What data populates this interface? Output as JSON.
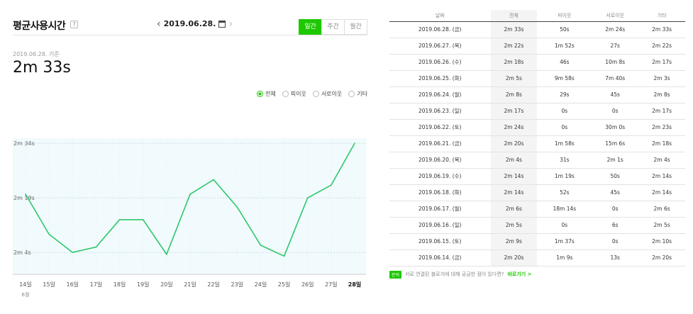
{
  "header": {
    "title": "평균사용시간",
    "help_icon": "?",
    "date": "2019.06.28.",
    "tabs": [
      "일간",
      "주간",
      "월간"
    ],
    "active_tab": 0
  },
  "summary": {
    "basis": "2019.06.28. 기준",
    "value": "2m 33s"
  },
  "legend": {
    "items": [
      "전체",
      "피이웃",
      "서로이웃",
      "기타"
    ],
    "selected": 0
  },
  "chart_data": {
    "type": "line",
    "x": [
      "14일",
      "15일",
      "16일",
      "17일",
      "18일",
      "19일",
      "20일",
      "21일",
      "22일",
      "23일",
      "24일",
      "25일",
      "26일",
      "27일",
      "28일"
    ],
    "x_month_label": "6월",
    "y_tick_labels": [
      "2m 34s",
      "2m 19s",
      "2m 4s"
    ],
    "series": [
      {
        "color": "#2ec76a",
        "values_seconds": [
          140,
          129,
          124,
          125.5,
          133,
          133,
          123.5,
          140,
          144,
          136.5,
          126,
          123,
          139,
          142.5,
          154
        ]
      }
    ],
    "ylim_seconds": [
      118,
      155
    ],
    "grid": true
  },
  "table": {
    "columns": [
      "날짜",
      "전체",
      "피이웃",
      "서로이웃",
      "기타"
    ],
    "rows": [
      [
        "2019.06.28. (금)",
        "2m 33s",
        "50s",
        "2m 24s",
        "2m 33s"
      ],
      [
        "2019.06.27. (목)",
        "2m 22s",
        "1m 52s",
        "27s",
        "2m 22s"
      ],
      [
        "2019.06.26. (수)",
        "2m 18s",
        "46s",
        "10m 8s",
        "2m 17s"
      ],
      [
        "2019.06.25. (화)",
        "2m 5s",
        "9m 58s",
        "7m 40s",
        "2m 3s"
      ],
      [
        "2019.06.24. (월)",
        "2m 8s",
        "29s",
        "45s",
        "2m 8s"
      ],
      [
        "2019.06.23. (일)",
        "2m 17s",
        "0s",
        "0s",
        "2m 17s"
      ],
      [
        "2019.06.22. (토)",
        "2m 24s",
        "0s",
        "30m 0s",
        "2m 23s"
      ],
      [
        "2019.06.21. (금)",
        "2m 20s",
        "1m 58s",
        "15m 6s",
        "2m 18s"
      ],
      [
        "2019.06.20. (목)",
        "2m 4s",
        "31s",
        "2m 1s",
        "2m 4s"
      ],
      [
        "2019.06.19. (수)",
        "2m 14s",
        "1m 19s",
        "50s",
        "2m 14s"
      ],
      [
        "2019.06.18. (화)",
        "2m 14s",
        "52s",
        "45s",
        "2m 14s"
      ],
      [
        "2019.06.17. (월)",
        "2m 6s",
        "18m 14s",
        "0s",
        "2m 6s"
      ],
      [
        "2019.06.16. (일)",
        "2m 5s",
        "0s",
        "6s",
        "2m 5s"
      ],
      [
        "2019.06.15. (토)",
        "2m 9s",
        "1m 37s",
        "0s",
        "2m 10s"
      ],
      [
        "2019.06.14. (금)",
        "2m 20s",
        "1m 9s",
        "13s",
        "2m 20s"
      ]
    ]
  },
  "notice": {
    "badge": "문의",
    "text": "서로 연결된 블로거에 대해 궁금한 점이 있다면?",
    "link": "바로가기 >"
  }
}
